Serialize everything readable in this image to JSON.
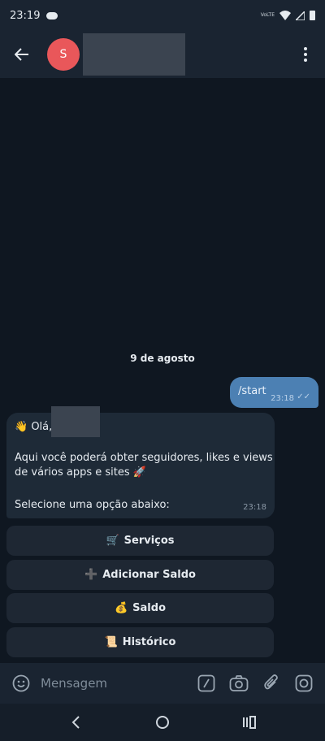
{
  "status": {
    "time": "23:19",
    "network": "VoLTE"
  },
  "header": {
    "avatar_letter": "S"
  },
  "chat": {
    "date": "9 de agosto",
    "outgoing": {
      "text": "/start",
      "time": "23:18"
    },
    "incoming": {
      "greeting": "👋 Olá,",
      "line1": "Aqui você poderá obter seguidores, likes e views",
      "line2": "de vários apps e sites 🚀",
      "line3": "Selecione uma opção abaixo:",
      "time": "23:18"
    },
    "buttons": [
      {
        "emoji": "🛒",
        "label": "Serviços"
      },
      {
        "emoji": "➕",
        "label": "Adicionar Saldo"
      },
      {
        "emoji": "💰",
        "label": "Saldo"
      },
      {
        "emoji": "📜",
        "label": "Histórico"
      }
    ]
  },
  "input": {
    "placeholder": "Mensagem"
  },
  "colors": {
    "accent": "#4c80b3",
    "avatar": "#e9575a",
    "background": "#0f1721"
  }
}
